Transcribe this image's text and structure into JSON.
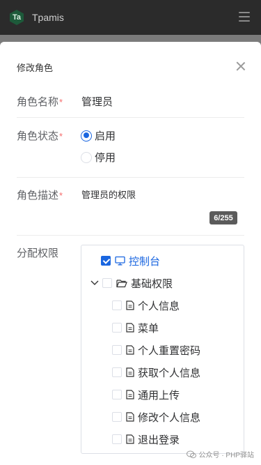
{
  "app": {
    "logo_text": "Ta",
    "title": "Tpamis"
  },
  "modal": {
    "title": "修改角色",
    "fields": {
      "name_label": "角色名称",
      "name_value": "管理员",
      "status_label": "角色状态",
      "status_options": [
        "启用",
        "停用"
      ],
      "status_selected": "启用",
      "desc_label": "角色描述",
      "desc_value": "管理员的权限",
      "desc_counter": "6/255",
      "perm_label": "分配权限",
      "required_mark": "*"
    },
    "tree": {
      "root": {
        "label": "控制台",
        "checked": true
      },
      "group": {
        "label": "基础权限",
        "expanded": true,
        "checked": false
      },
      "children": [
        "个人信息",
        "菜单",
        "个人重置密码",
        "获取个人信息",
        "通用上传",
        "修改个人信息",
        "退出登录"
      ]
    }
  },
  "watermark": {
    "text": "公众号 · PHP驿站"
  },
  "colors": {
    "accent": "#1a66e0",
    "required": "#f56c6c",
    "header_bg": "#2b2b2b",
    "overlay": "#7b7b7b"
  }
}
